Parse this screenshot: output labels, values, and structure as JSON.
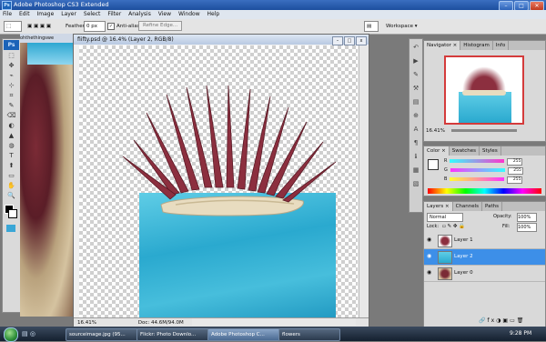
{
  "window": {
    "title": "Adobe Photoshop CS3 Extended",
    "logo": "Ps",
    "min": "–",
    "max": "□",
    "close": "✕"
  },
  "menu": [
    "File",
    "Edit",
    "Image",
    "Layer",
    "Select",
    "Filter",
    "Analysis",
    "View",
    "Window",
    "Help"
  ],
  "options": {
    "feather_label": "Feather:",
    "feather_value": "0 px",
    "antialias_label": "Anti-alias",
    "antialias_checked": "✓",
    "refine_label": "Refine Edge...",
    "workspace_label": "Workspace ▾"
  },
  "tools": [
    "⬚",
    "✥",
    "⌁",
    "⊹",
    "⌗",
    "✎",
    "⌫",
    "◐",
    "▲",
    "◍",
    "T",
    "⬆",
    "▭",
    "✋",
    "🔍"
  ],
  "background_document": {
    "tab": "ohthethingswe"
  },
  "document": {
    "title": "fiifty.psd @ 16.4% (Layer 2, RGB/8)",
    "zoom": "16.41%",
    "doc_size": "Doc: 44.6M/94.0M",
    "btn_min": "–",
    "btn_max": "□",
    "btn_close": "x"
  },
  "navigator": {
    "tabs": [
      "Navigator ×",
      "Histogram",
      "Info"
    ],
    "zoom": "16.41%"
  },
  "color": {
    "tabs": [
      "Color ×",
      "Swatches",
      "Styles"
    ],
    "rows": [
      {
        "label": "R",
        "value": "255"
      },
      {
        "label": "G",
        "value": "255"
      },
      {
        "label": "B",
        "value": "255"
      }
    ],
    "colors": {
      "r_bar": "#ff33cc",
      "g_bar": "#33ffff",
      "b_bar": "#ffff33"
    }
  },
  "layers": {
    "tabs": [
      "Layers ×",
      "Channels",
      "Paths"
    ],
    "blend_mode": "Normal",
    "opacity_label": "Opacity:",
    "opacity_value": "100%",
    "lock_label": "Lock:",
    "fill_label": "Fill:",
    "fill_value": "100%",
    "items": [
      {
        "name": "Layer 1",
        "selected": false
      },
      {
        "name": "Layer 2",
        "selected": true
      },
      {
        "name": "Layer 0",
        "selected": false
      }
    ],
    "footer_icons": [
      "🔗",
      "fx",
      "◑",
      "▣",
      "▭",
      "🗑"
    ]
  },
  "taskbar": {
    "items": [
      {
        "label": "sourceimage.jpg (95..."
      },
      {
        "label": "Flickr: Photo Downlo..."
      },
      {
        "label": "Adobe Photoshop C..."
      },
      {
        "label": "flowers"
      }
    ],
    "clock": "9:28 PM"
  }
}
